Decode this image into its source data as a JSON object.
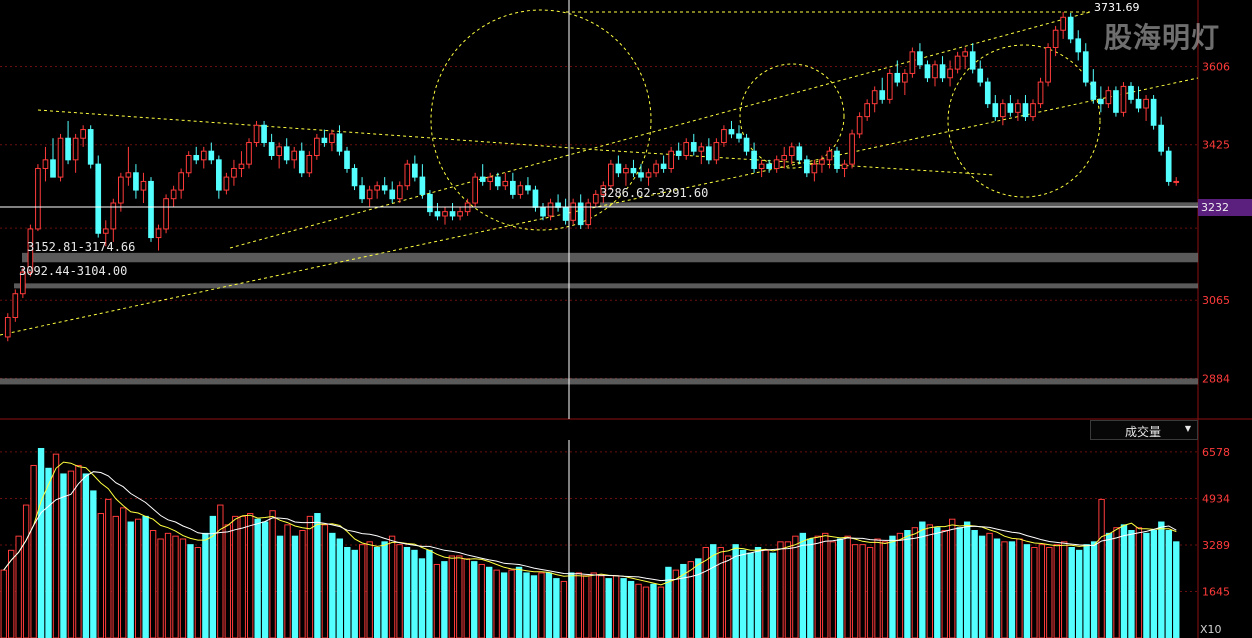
{
  "watermark": "股海明灯",
  "volume_indicator": {
    "selected": "成交量"
  },
  "current_price_label": "3232",
  "volume_multiplier": "X10",
  "annotations": {
    "high": "3731.69",
    "gap1": "3152.81-3174.66",
    "gap2": "3092.44-3104.00",
    "gap3": "3286.62-3291.60"
  },
  "colors": {
    "up": "#ff3b3b",
    "down": "#54ffff",
    "ma1": "#ffffff",
    "ma2": "#ffff40",
    "trendline": "#ffff40",
    "band": "#6a6a6a",
    "axis_text": "#ff3b3b",
    "background": "#000000"
  },
  "chart_data": [
    {
      "type": "candlestick",
      "ylim": [
        2790,
        3760
      ],
      "y_ticks": [
        "3606",
        "3425",
        "3232",
        "3065",
        "2884"
      ],
      "gap_bands": [
        {
          "low": 3152.81,
          "high": 3174.66
        },
        {
          "low": 3092.44,
          "high": 3104.0
        },
        {
          "low": 3286.62,
          "high": 3291.6
        },
        {
          "low": 2870,
          "high": 2884
        }
      ],
      "ohlc": [
        [
          2980,
          3035,
          2970,
          3025
        ],
        [
          3025,
          3090,
          3015,
          3080
        ],
        [
          3080,
          3140,
          3070,
          3130
        ],
        [
          3130,
          3240,
          3120,
          3230
        ],
        [
          3230,
          3380,
          3225,
          3370
        ],
        [
          3370,
          3420,
          3340,
          3390
        ],
        [
          3390,
          3440,
          3360,
          3350
        ],
        [
          3350,
          3450,
          3340,
          3440
        ],
        [
          3440,
          3480,
          3380,
          3390
        ],
        [
          3390,
          3450,
          3360,
          3440
        ],
        [
          3440,
          3470,
          3420,
          3460
        ],
        [
          3460,
          3470,
          3370,
          3380
        ],
        [
          3380,
          3400,
          3210,
          3220
        ],
        [
          3220,
          3250,
          3190,
          3230
        ],
        [
          3230,
          3300,
          3200,
          3290
        ],
        [
          3290,
          3360,
          3270,
          3350
        ],
        [
          3350,
          3420,
          3330,
          3360
        ],
        [
          3360,
          3380,
          3300,
          3320
        ],
        [
          3320,
          3360,
          3290,
          3340
        ],
        [
          3340,
          3350,
          3200,
          3210
        ],
        [
          3210,
          3240,
          3180,
          3230
        ],
        [
          3230,
          3310,
          3220,
          3300
        ],
        [
          3300,
          3330,
          3280,
          3320
        ],
        [
          3320,
          3370,
          3300,
          3360
        ],
        [
          3360,
          3410,
          3350,
          3400
        ],
        [
          3400,
          3420,
          3380,
          3390
        ],
        [
          3390,
          3420,
          3370,
          3410
        ],
        [
          3410,
          3430,
          3380,
          3390
        ],
        [
          3390,
          3400,
          3300,
          3320
        ],
        [
          3320,
          3360,
          3310,
          3350
        ],
        [
          3350,
          3390,
          3330,
          3370
        ],
        [
          3370,
          3410,
          3350,
          3380
        ],
        [
          3380,
          3440,
          3370,
          3430
        ],
        [
          3430,
          3480,
          3420,
          3470
        ],
        [
          3470,
          3480,
          3420,
          3430
        ],
        [
          3430,
          3450,
          3390,
          3400
        ],
        [
          3400,
          3430,
          3370,
          3420
        ],
        [
          3420,
          3440,
          3380,
          3390
        ],
        [
          3390,
          3420,
          3370,
          3410
        ],
        [
          3410,
          3430,
          3350,
          3360
        ],
        [
          3360,
          3410,
          3350,
          3400
        ],
        [
          3400,
          3450,
          3390,
          3440
        ],
        [
          3440,
          3460,
          3420,
          3430
        ],
        [
          3430,
          3460,
          3410,
          3450
        ],
        [
          3450,
          3470,
          3400,
          3410
        ],
        [
          3410,
          3420,
          3360,
          3370
        ],
        [
          3370,
          3380,
          3320,
          3330
        ],
        [
          3330,
          3350,
          3290,
          3300
        ],
        [
          3300,
          3330,
          3280,
          3320
        ],
        [
          3320,
          3340,
          3300,
          3330
        ],
        [
          3330,
          3350,
          3310,
          3320
        ],
        [
          3320,
          3340,
          3290,
          3300
        ],
        [
          3300,
          3340,
          3290,
          3330
        ],
        [
          3330,
          3390,
          3320,
          3380
        ],
        [
          3380,
          3400,
          3340,
          3350
        ],
        [
          3350,
          3380,
          3300,
          3310
        ],
        [
          3310,
          3320,
          3260,
          3270
        ],
        [
          3270,
          3290,
          3250,
          3260
        ],
        [
          3260,
          3280,
          3240,
          3270
        ],
        [
          3270,
          3290,
          3250,
          3260
        ],
        [
          3260,
          3280,
          3250,
          3270
        ],
        [
          3270,
          3300,
          3260,
          3290
        ],
        [
          3290,
          3360,
          3280,
          3350
        ],
        [
          3350,
          3380,
          3330,
          3340
        ],
        [
          3340,
          3360,
          3320,
          3350
        ],
        [
          3350,
          3360,
          3320,
          3330
        ],
        [
          3330,
          3360,
          3320,
          3340
        ],
        [
          3340,
          3360,
          3300,
          3310
        ],
        [
          3310,
          3340,
          3300,
          3330
        ],
        [
          3330,
          3350,
          3310,
          3320
        ],
        [
          3320,
          3330,
          3270,
          3280
        ],
        [
          3280,
          3290,
          3250,
          3260
        ],
        [
          3260,
          3300,
          3250,
          3290
        ],
        [
          3290,
          3310,
          3270,
          3280
        ],
        [
          3280,
          3300,
          3240,
          3250
        ],
        [
          3250,
          3300,
          3240,
          3290
        ],
        [
          3290,
          3310,
          3230,
          3240
        ],
        [
          3240,
          3300,
          3230,
          3290
        ],
        [
          3290,
          3320,
          3280,
          3310
        ],
        [
          3310,
          3340,
          3290,
          3330
        ],
        [
          3330,
          3390,
          3320,
          3380
        ],
        [
          3380,
          3400,
          3350,
          3360
        ],
        [
          3360,
          3380,
          3330,
          3370
        ],
        [
          3370,
          3390,
          3350,
          3360
        ],
        [
          3360,
          3380,
          3340,
          3350
        ],
        [
          3350,
          3370,
          3330,
          3360
        ],
        [
          3360,
          3390,
          3350,
          3380
        ],
        [
          3380,
          3400,
          3360,
          3370
        ],
        [
          3370,
          3420,
          3360,
          3410
        ],
        [
          3410,
          3430,
          3390,
          3400
        ],
        [
          3400,
          3440,
          3390,
          3430
        ],
        [
          3430,
          3450,
          3400,
          3410
        ],
        [
          3410,
          3430,
          3380,
          3420
        ],
        [
          3420,
          3440,
          3380,
          3390
        ],
        [
          3390,
          3440,
          3380,
          3430
        ],
        [
          3430,
          3470,
          3420,
          3460
        ],
        [
          3460,
          3480,
          3440,
          3450
        ],
        [
          3450,
          3470,
          3430,
          3440
        ],
        [
          3440,
          3450,
          3400,
          3410
        ],
        [
          3410,
          3430,
          3360,
          3370
        ],
        [
          3370,
          3390,
          3350,
          3380
        ],
        [
          3380,
          3390,
          3360,
          3370
        ],
        [
          3370,
          3400,
          3360,
          3390
        ],
        [
          3390,
          3420,
          3370,
          3400
        ],
        [
          3400,
          3430,
          3380,
          3420
        ],
        [
          3420,
          3430,
          3380,
          3390
        ],
        [
          3390,
          3400,
          3350,
          3360
        ],
        [
          3360,
          3390,
          3340,
          3380
        ],
        [
          3380,
          3400,
          3360,
          3390
        ],
        [
          3390,
          3420,
          3370,
          3410
        ],
        [
          3410,
          3420,
          3360,
          3370
        ],
        [
          3370,
          3390,
          3350,
          3380
        ],
        [
          3380,
          3460,
          3370,
          3450
        ],
        [
          3450,
          3500,
          3440,
          3490
        ],
        [
          3490,
          3530,
          3480,
          3520
        ],
        [
          3520,
          3560,
          3500,
          3550
        ],
        [
          3550,
          3580,
          3520,
          3530
        ],
        [
          3530,
          3600,
          3520,
          3590
        ],
        [
          3590,
          3620,
          3560,
          3570
        ],
        [
          3570,
          3600,
          3540,
          3590
        ],
        [
          3590,
          3650,
          3580,
          3640
        ],
        [
          3640,
          3660,
          3600,
          3610
        ],
        [
          3610,
          3620,
          3570,
          3580
        ],
        [
          3580,
          3620,
          3560,
          3610
        ],
        [
          3610,
          3630,
          3570,
          3580
        ],
        [
          3580,
          3620,
          3560,
          3600
        ],
        [
          3600,
          3640,
          3590,
          3630
        ],
        [
          3630,
          3650,
          3600,
          3640
        ],
        [
          3640,
          3660,
          3590,
          3600
        ],
        [
          3600,
          3620,
          3560,
          3570
        ],
        [
          3570,
          3580,
          3510,
          3520
        ],
        [
          3520,
          3540,
          3480,
          3490
        ],
        [
          3490,
          3530,
          3470,
          3520
        ],
        [
          3520,
          3540,
          3490,
          3500
        ],
        [
          3500,
          3530,
          3480,
          3520
        ],
        [
          3520,
          3540,
          3480,
          3490
        ],
        [
          3490,
          3530,
          3480,
          3520
        ],
        [
          3520,
          3580,
          3510,
          3570
        ],
        [
          3570,
          3660,
          3560,
          3650
        ],
        [
          3650,
          3700,
          3630,
          3690
        ],
        [
          3690,
          3732,
          3670,
          3720
        ],
        [
          3720,
          3730,
          3660,
          3670
        ],
        [
          3670,
          3690,
          3620,
          3640
        ],
        [
          3640,
          3660,
          3560,
          3570
        ],
        [
          3570,
          3600,
          3520,
          3530
        ],
        [
          3530,
          3560,
          3500,
          3520
        ],
        [
          3520,
          3560,
          3510,
          3550
        ],
        [
          3550,
          3560,
          3490,
          3500
        ],
        [
          3500,
          3570,
          3490,
          3560
        ],
        [
          3560,
          3570,
          3520,
          3530
        ],
        [
          3530,
          3560,
          3500,
          3510
        ],
        [
          3510,
          3540,
          3480,
          3530
        ],
        [
          3530,
          3540,
          3460,
          3470
        ],
        [
          3470,
          3490,
          3400,
          3410
        ],
        [
          3410,
          3420,
          3330,
          3340
        ],
        [
          3340,
          3350,
          3330,
          3340
        ]
      ]
    },
    {
      "type": "bar",
      "name": "成交量",
      "ylim": [
        0,
        7000
      ],
      "y_ticks": [
        "6578",
        "4934",
        "3289",
        "1645"
      ],
      "up_down": [
        1,
        1,
        1,
        1,
        1,
        0,
        0,
        1,
        0,
        1,
        1,
        0,
        0,
        1,
        1,
        1,
        1,
        0,
        1,
        0,
        1,
        1,
        1,
        1,
        1,
        0,
        1,
        0,
        0,
        1,
        1,
        1,
        1,
        1,
        0,
        0,
        1,
        0,
        1,
        0,
        1,
        1,
        0,
        1,
        0,
        0,
        0,
        0,
        1,
        1,
        0,
        0,
        1,
        1,
        0,
        0,
        0,
        0,
        1,
        0,
        1,
        1,
        1,
        0,
        1,
        0,
        1,
        0,
        1,
        0,
        0,
        0,
        1,
        0,
        0,
        1,
        0,
        1,
        1,
        1,
        1,
        0,
        1,
        0,
        0,
        1,
        1,
        0,
        1,
        0,
        1,
        0,
        1,
        0,
        1,
        0,
        1,
        1,
        0,
        0,
        0,
        0,
        1,
        0,
        1,
        1,
        1,
        0,
        0,
        1,
        1,
        1,
        0,
        1,
        1,
        1,
        1,
        1,
        1,
        0,
        1,
        0,
        1,
        0,
        1,
        0,
        1,
        1,
        0,
        0,
        0,
        0,
        1,
        0,
        1,
        0,
        1,
        0,
        1,
        1,
        1,
        1,
        1,
        0,
        0,
        0,
        0,
        1,
        0,
        1,
        0,
        0,
        1,
        0,
        0,
        0,
        0
      ],
      "values": [
        2400,
        3100,
        3600,
        4700,
        6100,
        6700,
        6000,
        6500,
        5800,
        5900,
        6100,
        5800,
        5200,
        4400,
        4900,
        4300,
        4600,
        4100,
        4200,
        4300,
        3800,
        3500,
        3700,
        3600,
        3500,
        3300,
        3200,
        3700,
        4300,
        4700,
        4000,
        4300,
        4300,
        4400,
        4200,
        4100,
        4500,
        3600,
        4000,
        3600,
        3800,
        4300,
        4400,
        4000,
        3700,
        3500,
        3200,
        3100,
        3300,
        3400,
        3200,
        3400,
        3600,
        3300,
        3200,
        3100,
        2800,
        3100,
        2600,
        2700,
        2900,
        2900,
        2800,
        2700,
        2600,
        2500,
        2400,
        2300,
        2400,
        2500,
        2300,
        2200,
        2300,
        2300,
        2100,
        2000,
        2300,
        2300,
        2200,
        2300,
        2200,
        2100,
        2200,
        2100,
        2000,
        1900,
        1800,
        1900,
        1800,
        2500,
        2400,
        2600,
        2700,
        2800,
        3200,
        3300,
        3200,
        2900,
        3300,
        3100,
        3000,
        3200,
        3100,
        3000,
        3400,
        3400,
        3600,
        3700,
        3500,
        3600,
        3700,
        3400,
        3500,
        3600,
        3300,
        3300,
        3200,
        3500,
        3400,
        3600,
        3700,
        3800,
        3900,
        4100,
        4000,
        3900,
        3800,
        4200,
        3900,
        4100,
        3800,
        3600,
        3700,
        3500,
        3400,
        3400,
        3500,
        3300,
        3200,
        3300,
        3200,
        3300,
        3400,
        3200,
        3100,
        3300,
        3400,
        4900,
        3700,
        3900,
        4000,
        3800,
        3900,
        3700,
        3800,
        4100,
        3800,
        3400
      ]
    }
  ]
}
